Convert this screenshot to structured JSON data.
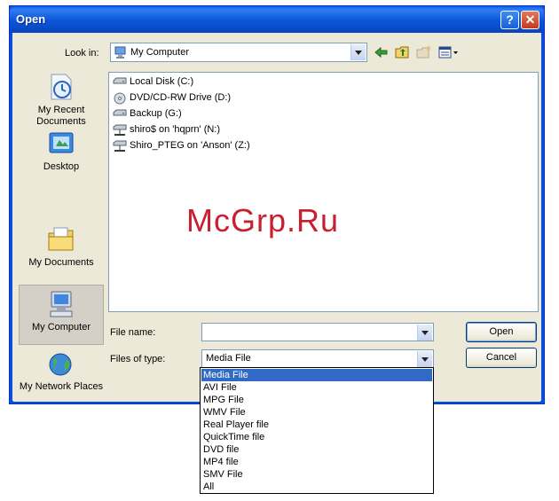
{
  "window": {
    "title": "Open",
    "help_label": "?",
    "close_label": "✕"
  },
  "lookin": {
    "label": "Look in:",
    "value": "My Computer",
    "icon": "my-computer-icon"
  },
  "toolbar": {
    "back_icon": "back-arrow-icon",
    "up_icon": "up-folder-icon",
    "new_folder_icon": "new-folder-icon",
    "views_icon": "views-menu-icon"
  },
  "places": [
    {
      "label": "My Recent Documents",
      "icon": "recent-documents-icon"
    },
    {
      "label": "Desktop",
      "icon": "desktop-icon"
    },
    {
      "label": "My Documents",
      "icon": "my-documents-icon"
    },
    {
      "label": "My Computer",
      "icon": "my-computer-icon",
      "selected": true
    },
    {
      "label": "My Network Places",
      "icon": "network-places-icon"
    }
  ],
  "files": [
    {
      "label": "Local Disk (C:)",
      "icon": "hard-drive-icon"
    },
    {
      "label": "DVD/CD-RW Drive (D:)",
      "icon": "optical-drive-icon"
    },
    {
      "label": "Backup (G:)",
      "icon": "hard-drive-icon"
    },
    {
      "label": "shiro$ on 'hqprn' (N:)",
      "icon": "network-drive-icon"
    },
    {
      "label": "Shiro_PTEG on 'Anson' (Z:)",
      "icon": "network-drive-icon"
    }
  ],
  "watermark": "McGrp.Ru",
  "filename": {
    "label": "File name:",
    "value": ""
  },
  "filetype": {
    "label": "Files of type:",
    "value": "Media File",
    "options": [
      "Media File",
      "AVI File",
      "MPG File",
      "WMV File",
      "Real Player file",
      "QuickTime file",
      "DVD file",
      "MP4 file",
      "SMV File",
      "All"
    ],
    "selected_index": 0
  },
  "buttons": {
    "open": "Open",
    "cancel": "Cancel"
  },
  "colors": {
    "title_bar": "#0a56d8",
    "selection": "#316ac5",
    "watermark": "#c82030"
  }
}
